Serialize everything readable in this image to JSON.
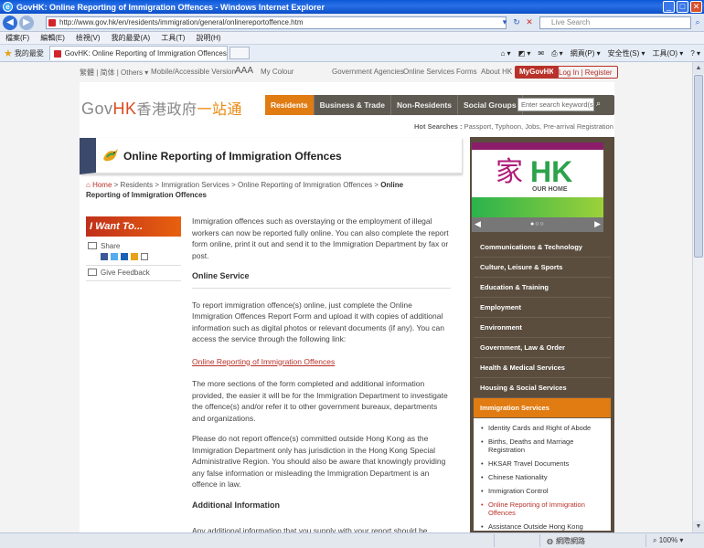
{
  "browser": {
    "title": "GovHK: Online Reporting of Immigration Offences - Windows Internet Explorer",
    "url": "http://www.gov.hk/en/residents/immigration/general/onlinereportoffence.htm",
    "search_placeholder": "Live Search",
    "menu": [
      "檔案(F)",
      "編輯(E)",
      "檢視(V)",
      "我的最愛(A)",
      "工具(T)",
      "說明(H)"
    ],
    "favorites_label": "我的最愛",
    "tab_label": "GovHK: Online Reporting of Immigration Offences",
    "commands": [
      "網頁(P) ▾",
      "安全性(S) ▾",
      "工具(O) ▾"
    ],
    "status_zone": "網際網路",
    "status_zoom": "100%"
  },
  "util": {
    "lang": "繁體 | 简体 | Others ▾",
    "mobile": "Mobile/Accessible Version",
    "font_size": "AAA",
    "my_colour": "My Colour",
    "links": [
      "Government Agencies",
      "Online Services",
      "Forms",
      "About HK"
    ],
    "mygovhk": "MyGovHK",
    "login": "Log In | Register"
  },
  "header": {
    "logo_gov": "Gov",
    "logo_hk": "HK",
    "logo_chi": "香港政府",
    "logo_chi2": "一站通",
    "nav": [
      "Residents",
      "Business & Trade",
      "Non-Residents",
      "Social Groups"
    ],
    "keyword_placeholder": "Enter search keyword(s)",
    "hot_label": "Hot Searches :",
    "hot_terms": "Passport, Typhoon, Jobs, Pre-arrival Registration"
  },
  "page": {
    "title": "Online Reporting of Immigration Offences",
    "breadcrumb": {
      "home": "Home",
      "trail": " > Residents > Immigration Services > Online Reporting of Immigration Offences > ",
      "current": "Online Reporting of Immigration Offences"
    },
    "i_want_to": "I Want To...",
    "share": "Share",
    "feedback": "Give Feedback",
    "intro": "Immigration offences such as overstaying or the employment of illegal workers can now be reported fully online. You can also complete the report form online, print it out and send it to the Immigration Department by fax or post.",
    "h_online": "Online Service",
    "p_online": "To report immigration offence(s) online, just complete the Online Immigration Offences Report Form and upload it with copies of additional information such as digital photos or relevant documents (if any). You can access the service through the following link:",
    "link": "Online Reporting of Immigration Offences",
    "p_more": "The more sections of the form completed and additional information provided, the easier it will be for the Immigration Department to investigate the offence(s) and/or refer it to other government bureaux, departments and organizations.",
    "p_outside": "Please do not report offence(s) committed outside Hong Kong as the Immigration Department only has jurisdiction in the Hong Kong Special Administrative Region. You should also be aware that knowingly providing any false information or misleading the Immigration Department is an offence in law.",
    "h_additional": "Additional Information",
    "p_additional": "Any additional information that you supply with your report should be"
  },
  "right": {
    "banner_jia": "家",
    "banner_hk": "HK",
    "banner_our": "OUR HOME",
    "categories": [
      "Communications & Technology",
      "Culture, Leisure & Sports",
      "Education & Training",
      "Employment",
      "Environment",
      "Government, Law & Order",
      "Health & Medical Services",
      "Housing & Social Services",
      "Immigration Services"
    ],
    "sub": [
      "Identity Cards and Right of Abode",
      "Births, Deaths and Marriage Registration",
      "HKSAR Travel Documents",
      "Chinese Nationality",
      "Immigration Control",
      "Online Reporting of Immigration Offences",
      "Assistance Outside Hong Kong"
    ]
  },
  "colors": {
    "accent_orange": "#e07c12",
    "brand_red": "#b8322a",
    "nav_dark": "#5e5a52",
    "sidebar_brown": "#5a4d3e"
  }
}
